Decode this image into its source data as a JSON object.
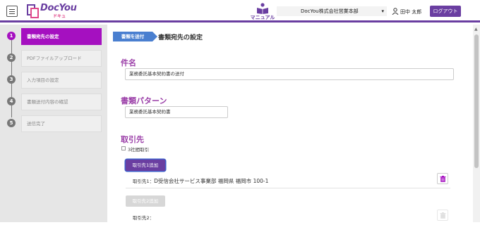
{
  "header": {
    "logo_text": "DocYou",
    "logo_sub": "ドキュ",
    "manual_label": "マニュアル",
    "company": "DocYou株式会社営業本部",
    "user_name": "田中 太郎",
    "logout_label": "ログアウト"
  },
  "steps": [
    {
      "num": "1",
      "label": "書類宛先の設定",
      "active": true
    },
    {
      "num": "2",
      "label": "PDFファイルアップロード",
      "active": false
    },
    {
      "num": "3",
      "label": "入力項目の設定",
      "active": false
    },
    {
      "num": "4",
      "label": "書類送付内容の確認",
      "active": false
    },
    {
      "num": "5",
      "label": "送信完了",
      "active": false
    }
  ],
  "main": {
    "crumb_tag": "書類を送付",
    "crumb_title": "書類宛先の設定",
    "subject_title": "件名",
    "subject_value": "業務委託基本契約書の送付",
    "pattern_title": "書類パターン",
    "pattern_value": "業務委託基本契約書",
    "client_title": "取引先",
    "three_party_label": "3社間取引",
    "add_client1_label": "取引先1追加",
    "client1_label": "取引先1：",
    "client1_value": "D受信会社サービス事業部 福岡県 福岡市 100-1",
    "add_client2_label": "取引先2追加",
    "client2_label": "取引先2：",
    "client2_value": ""
  },
  "colors": {
    "brand": "#6a3ea1",
    "step_active": "#a510c0",
    "section_title": "#9b3fa8",
    "crumb_tag": "#4a7fd0",
    "trash": "#a510c0"
  }
}
